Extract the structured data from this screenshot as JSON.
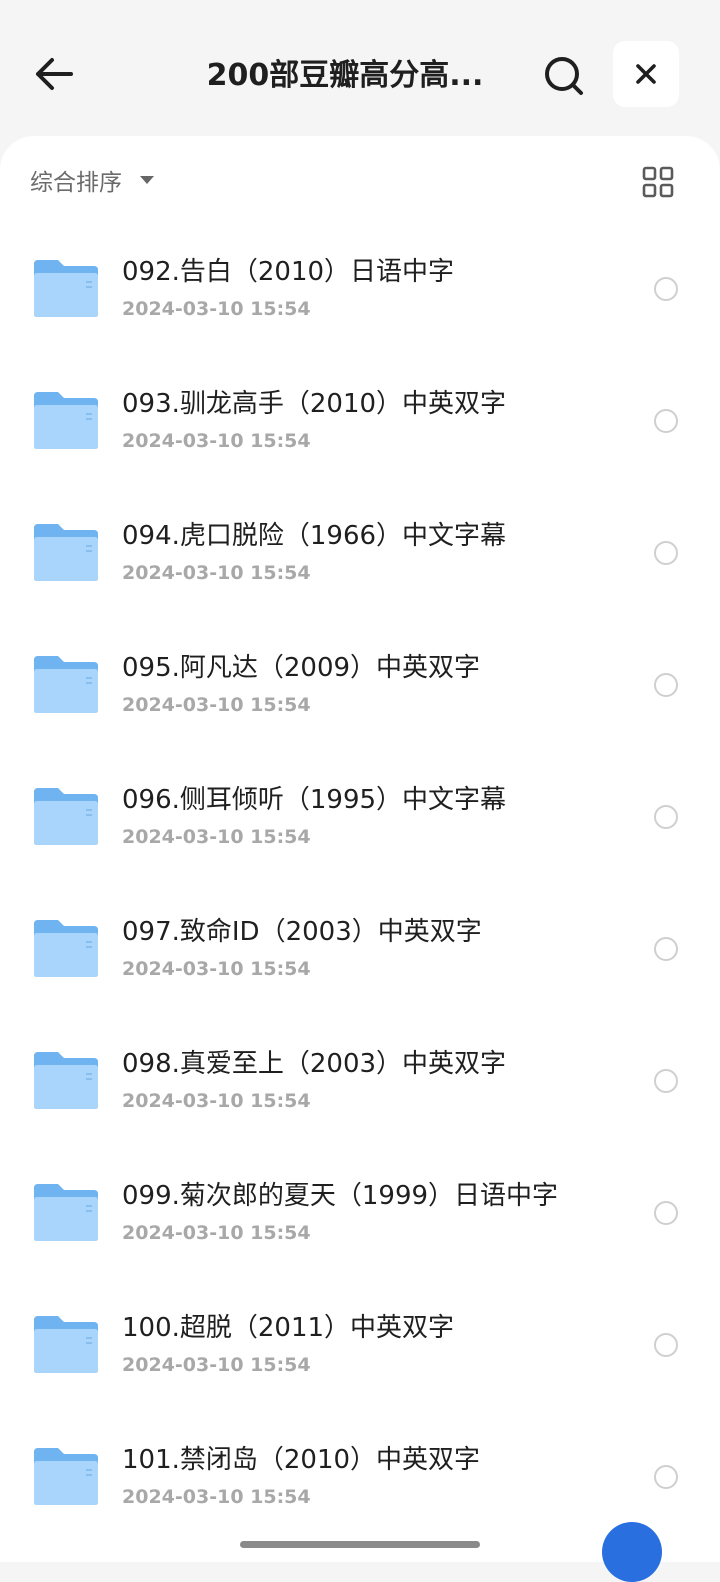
{
  "header": {
    "title": "200部豆瓣高分高...",
    "back_icon": "arrow-left-icon",
    "search_icon": "search-icon",
    "close_icon": "close-icon"
  },
  "toolbar": {
    "sort_label": "综合排序",
    "sort_icon": "caret-down-icon",
    "view_icon": "grid-view-icon"
  },
  "colors": {
    "folder": "#6fb3f0",
    "folder_light": "#a9d4fb",
    "accent": "#2a6fe0"
  },
  "files": [
    {
      "name": "092.告白（2010）日语中字",
      "date": "2024-03-10 15:54"
    },
    {
      "name": "093.驯龙高手（2010）中英双字",
      "date": "2024-03-10 15:54"
    },
    {
      "name": "094.虎口脱险（1966）中文字幕",
      "date": "2024-03-10 15:54"
    },
    {
      "name": "095.阿凡达（2009）中英双字",
      "date": "2024-03-10 15:54"
    },
    {
      "name": "096.侧耳倾听（1995）中文字幕",
      "date": "2024-03-10 15:54"
    },
    {
      "name": "097.致命ID（2003）中英双字",
      "date": "2024-03-10 15:54"
    },
    {
      "name": "098.真爱至上（2003）中英双字",
      "date": "2024-03-10 15:54"
    },
    {
      "name": "099.菊次郎的夏天（1999）日语中字",
      "date": "2024-03-10 15:54"
    },
    {
      "name": "100.超脱（2011）中英双字",
      "date": "2024-03-10 15:54"
    },
    {
      "name": "101.禁闭岛（2010）中英双字",
      "date": "2024-03-10 15:54"
    }
  ]
}
